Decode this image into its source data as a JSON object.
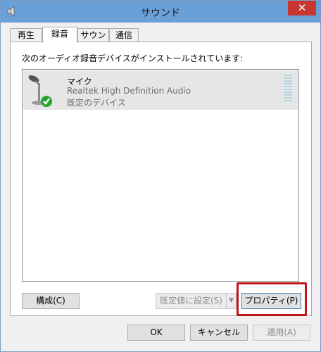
{
  "window": {
    "title": "サウンド",
    "close_glyph": "✕"
  },
  "tabs": [
    {
      "label": "再生"
    },
    {
      "label": "録音"
    },
    {
      "label": "サウンド"
    },
    {
      "label": "通信"
    }
  ],
  "active_tab": "録音",
  "panel": {
    "instruction": "次のオーディオ録音デバイスがインストールされています:"
  },
  "devices": [
    {
      "name": "マイク",
      "driver": "Realtek High Definition Audio",
      "status": "既定のデバイス",
      "icon": "microphone-icon",
      "badge_icon": "check-badge-icon"
    }
  ],
  "buttons": {
    "configure": "構成(C)",
    "set_default": "既定値に設定(S)",
    "properties": "プロパティ(P)",
    "ok": "OK",
    "cancel": "キャンセル",
    "apply": "適用(A)"
  },
  "colors": {
    "title_bar": "#6aa0d8",
    "close_button": "#c7372f",
    "highlight": "#c0141c",
    "selected_row": "#e6e6e6"
  }
}
